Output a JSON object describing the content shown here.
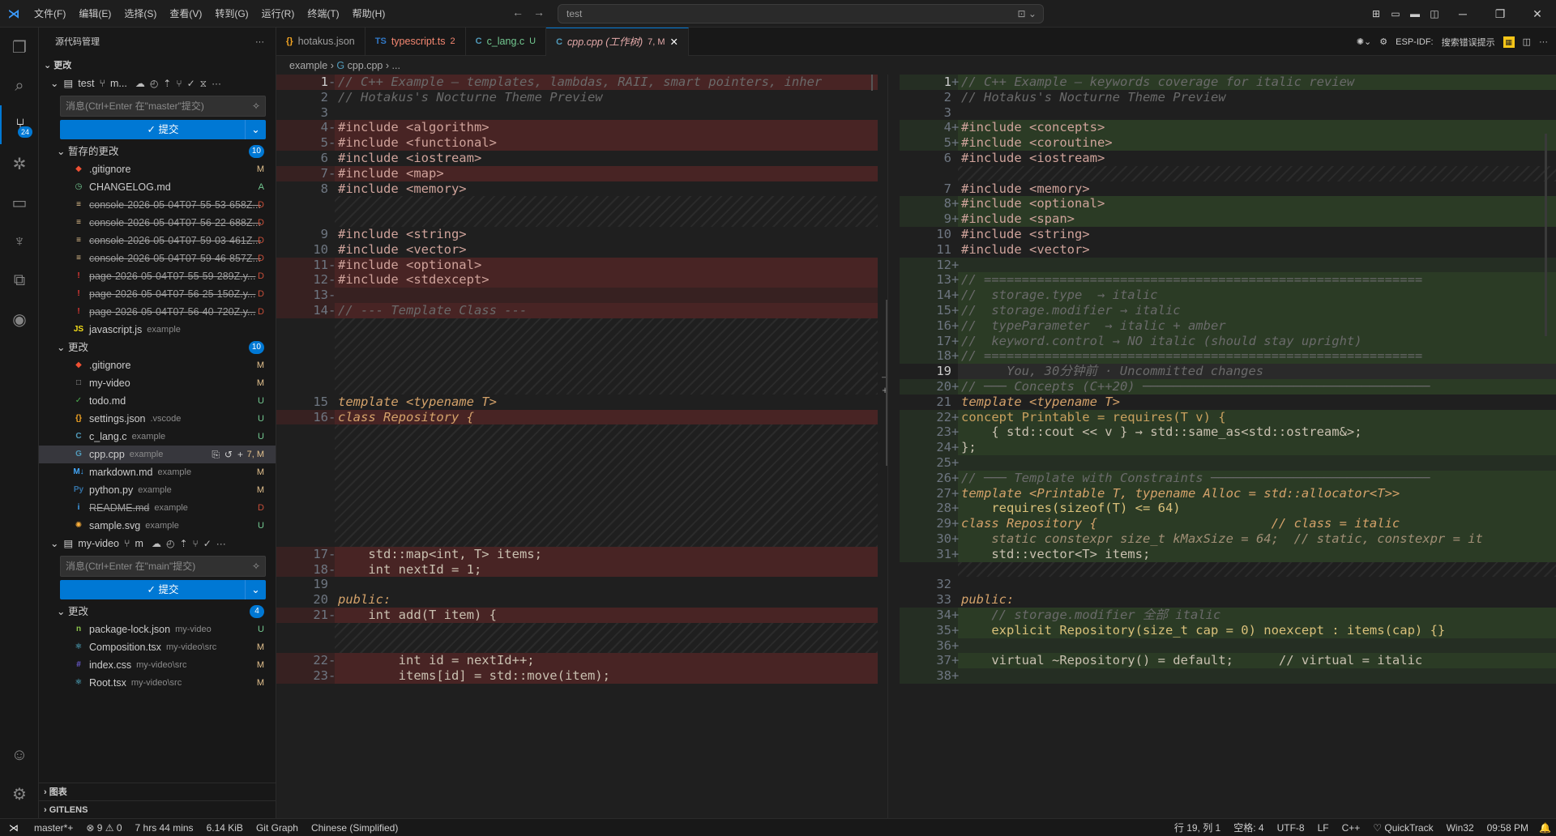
{
  "titlebar": {
    "menu": [
      "文件(F)",
      "编辑(E)",
      "选择(S)",
      "查看(V)",
      "转到(G)",
      "运行(R)",
      "终端(T)",
      "帮助(H)"
    ],
    "search": "test"
  },
  "activity_badge": "24",
  "sidebar": {
    "header": "源代码管理",
    "section": "更改",
    "repo1": {
      "name": "test",
      "branch_abbrev": "m...",
      "message_placeholder": "消息(Ctrl+Enter 在\"master\"提交)",
      "commit_label": "✓ 提交",
      "staged_label": "暂存的更改",
      "staged_count": "10",
      "staged": [
        {
          "name": ".gitignore",
          "dir": "",
          "status": "M",
          "deleted": false,
          "icon": "git"
        },
        {
          "name": "CHANGELOG.md",
          "dir": "",
          "status": "A",
          "deleted": false,
          "icon": "history"
        },
        {
          "name": "console-2026-05-04T07-55-53-658Z...",
          "dir": "",
          "status": "D",
          "deleted": true,
          "icon": "log"
        },
        {
          "name": "console-2026-05-04T07-56-22-688Z...",
          "dir": "",
          "status": "D",
          "deleted": true,
          "icon": "log"
        },
        {
          "name": "console-2026-05-04T07-59-03-461Z...",
          "dir": "",
          "status": "D",
          "deleted": true,
          "icon": "log"
        },
        {
          "name": "console-2026-05-04T07-59-46-857Z...",
          "dir": "",
          "status": "D",
          "deleted": true,
          "icon": "log"
        },
        {
          "name": "page-2026-05-04T07-55-59-289Z.y...",
          "dir": "",
          "status": "D",
          "deleted": true,
          "icon": "yaml"
        },
        {
          "name": "page-2026-05-04T07-56-25-150Z.y...",
          "dir": "",
          "status": "D",
          "deleted": true,
          "icon": "yaml"
        },
        {
          "name": "page-2026-05-04T07-56-40-720Z.y...",
          "dir": "",
          "status": "D",
          "deleted": true,
          "icon": "yaml"
        },
        {
          "name": "javascript.js",
          "dir": "example",
          "status": "",
          "deleted": false,
          "icon": "js"
        }
      ],
      "changes_label": "更改",
      "changes_count": "10",
      "changes": [
        {
          "name": ".gitignore",
          "dir": "",
          "status": "M",
          "deleted": false,
          "icon": "git"
        },
        {
          "name": "my-video",
          "dir": "",
          "status": "M",
          "deleted": false,
          "icon": "file"
        },
        {
          "name": "todo.md",
          "dir": "",
          "status": "U",
          "deleted": false,
          "icon": "check"
        },
        {
          "name": "settings.json",
          "dir": ".vscode",
          "status": "U",
          "deleted": false,
          "icon": "json"
        },
        {
          "name": "c_lang.c",
          "dir": "example",
          "status": "U",
          "deleted": false,
          "icon": "c"
        },
        {
          "name": "cpp.cpp",
          "dir": "example",
          "status": "7, M",
          "deleted": false,
          "icon": "cpp",
          "selected": true
        },
        {
          "name": "markdown.md",
          "dir": "example",
          "status": "M",
          "deleted": false,
          "icon": "md"
        },
        {
          "name": "python.py",
          "dir": "example",
          "status": "M",
          "deleted": false,
          "icon": "py"
        },
        {
          "name": "README.md",
          "dir": "example",
          "status": "D",
          "deleted": true,
          "icon": "info"
        },
        {
          "name": "sample.svg",
          "dir": "example",
          "status": "U",
          "deleted": false,
          "icon": "svg"
        }
      ]
    },
    "repo2": {
      "name": "my-video",
      "branch_abbrev": "m",
      "message_placeholder": "消息(Ctrl+Enter 在\"main\"提交)",
      "commit_label": "✓ 提交",
      "changes_label": "更改",
      "changes_count": "4",
      "changes": [
        {
          "name": "package-lock.json",
          "dir": "my-video",
          "status": "U",
          "deleted": false,
          "icon": "npm"
        },
        {
          "name": "Composition.tsx",
          "dir": "my-video\\src",
          "status": "M",
          "deleted": false,
          "icon": "react"
        },
        {
          "name": "index.css",
          "dir": "my-video\\src",
          "status": "M",
          "deleted": false,
          "icon": "css"
        },
        {
          "name": "Root.tsx",
          "dir": "my-video\\src",
          "status": "M",
          "deleted": false,
          "icon": "react"
        }
      ]
    },
    "bottom": [
      "图表",
      "GITLENS"
    ]
  },
  "tabs": [
    {
      "icon": "{}",
      "label": "hotakus.json",
      "mod": "",
      "active": false
    },
    {
      "icon": "TS",
      "label": "typescript.ts",
      "mod": "2",
      "active": false
    },
    {
      "icon": "C",
      "label": "c_lang.c",
      "mod": "U",
      "active": false
    },
    {
      "icon": "C",
      "label": "cpp.cpp (工作树)",
      "mod": "7, M",
      "active": true
    }
  ],
  "tab_right": {
    "esp": "ESP-IDF:",
    "search_hint": "搜索错误提示"
  },
  "breadcrumb": [
    "example",
    "cpp.cpp",
    "..."
  ],
  "left_editor": [
    {
      "n": "1",
      "m": "-",
      "t": "del",
      "code": "// C++ Example — templates, lambdas, RAII, smart pointers, inher",
      "cls": "c-com"
    },
    {
      "n": "2",
      "m": " ",
      "t": "",
      "code": "// Hotakus's Nocturne Theme Preview",
      "cls": "c-com"
    },
    {
      "n": "3",
      "m": " ",
      "t": "",
      "code": "",
      "cls": ""
    },
    {
      "n": "4",
      "m": "-",
      "t": "del",
      "code": "#include <algorithm>",
      "cls": "c-inc"
    },
    {
      "n": "5",
      "m": "-",
      "t": "del",
      "code": "#include <functional>",
      "cls": "c-inc"
    },
    {
      "n": "6",
      "m": " ",
      "t": "",
      "code": "#include <iostream>",
      "cls": "c-inc"
    },
    {
      "n": "7",
      "m": "-",
      "t": "del",
      "code": "#include <map>",
      "cls": "c-inc"
    },
    {
      "n": "8",
      "m": " ",
      "t": "",
      "code": "#include <memory>",
      "cls": "c-inc"
    },
    {
      "filler": 2
    },
    {
      "n": "9",
      "m": " ",
      "t": "",
      "code": "#include <string>",
      "cls": "c-inc"
    },
    {
      "n": "10",
      "m": " ",
      "t": "",
      "code": "#include <vector>",
      "cls": "c-inc"
    },
    {
      "n": "11",
      "m": "-",
      "t": "del",
      "code": "#include <optional>",
      "cls": "c-inc"
    },
    {
      "n": "12",
      "m": "-",
      "t": "del",
      "code": "#include <stdexcept>",
      "cls": "c-inc"
    },
    {
      "n": "13",
      "m": "-",
      "t": "del",
      "code": "",
      "cls": ""
    },
    {
      "n": "14",
      "m": "-",
      "t": "del",
      "code": "// --- Template Class ---",
      "cls": "c-com"
    },
    {
      "filler": 5
    },
    {
      "n": "15",
      "m": " ",
      "t": "",
      "code": "template <typename T>",
      "cls": "c-kw"
    },
    {
      "n": "16",
      "m": "-",
      "t": "del",
      "code": "class Repository {",
      "cls": "c-kw"
    },
    {
      "filler": 8
    },
    {
      "n": "17",
      "m": "-",
      "t": "del",
      "code": "    std::map<int, T> items;",
      "cls": "c-pl"
    },
    {
      "n": "18",
      "m": "-",
      "t": "del",
      "code": "    int nextId = 1;",
      "cls": "c-pl"
    },
    {
      "n": "19",
      "m": " ",
      "t": "",
      "code": "",
      "cls": ""
    },
    {
      "n": "20",
      "m": " ",
      "t": "",
      "code": "public:",
      "cls": "c-kw"
    },
    {
      "n": "21",
      "m": "-",
      "t": "del",
      "code": "    int add(T item) {",
      "cls": "c-pl"
    },
    {
      "filler": 2
    },
    {
      "n": "22",
      "m": "-",
      "t": "del",
      "code": "        int id = nextId++;",
      "cls": "c-pl"
    },
    {
      "n": "23",
      "m": "-",
      "t": "del",
      "code": "        items[id] = std::move(item);",
      "cls": "c-pl"
    }
  ],
  "right_editor": [
    {
      "n": "1",
      "m": "+",
      "t": "add",
      "code": "// C++ Example — keywords coverage for italic review",
      "cls": "c-com"
    },
    {
      "n": "2",
      "m": " ",
      "t": "",
      "code": "// Hotakus's Nocturne Theme Preview",
      "cls": "c-com"
    },
    {
      "n": "3",
      "m": " ",
      "t": "",
      "code": "",
      "cls": ""
    },
    {
      "n": "4",
      "m": "+",
      "t": "add",
      "code": "#include <concepts>",
      "cls": "c-inc"
    },
    {
      "n": "5",
      "m": "+",
      "t": "add",
      "code": "#include <coroutine>",
      "cls": "c-inc"
    },
    {
      "n": "6",
      "m": " ",
      "t": "",
      "code": "#include <iostream>",
      "cls": "c-inc"
    },
    {
      "filler": 1
    },
    {
      "n": "7",
      "m": " ",
      "t": "",
      "code": "#include <memory>",
      "cls": "c-inc"
    },
    {
      "n": "8",
      "m": "+",
      "t": "add",
      "code": "#include <optional>",
      "cls": "c-inc"
    },
    {
      "n": "9",
      "m": "+",
      "t": "add",
      "code": "#include <span>",
      "cls": "c-inc"
    },
    {
      "n": "10",
      "m": " ",
      "t": "",
      "code": "#include <string>",
      "cls": "c-inc"
    },
    {
      "n": "11",
      "m": " ",
      "t": "",
      "code": "#include <vector>",
      "cls": "c-inc"
    },
    {
      "n": "12",
      "m": "+",
      "t": "add",
      "code": "",
      "cls": ""
    },
    {
      "n": "13",
      "m": "+",
      "t": "add",
      "code": "// ==========================================================",
      "cls": "c-com"
    },
    {
      "n": "14",
      "m": "+",
      "t": "add",
      "code": "//  storage.type  → italic",
      "cls": "c-com"
    },
    {
      "n": "15",
      "m": "+",
      "t": "add",
      "code": "//  storage.modifier → italic",
      "cls": "c-com"
    },
    {
      "n": "16",
      "m": "+",
      "t": "add",
      "code": "//  typeParameter  → italic + amber",
      "cls": "c-com"
    },
    {
      "n": "17",
      "m": "+",
      "t": "add",
      "code": "//  keyword.control → NO italic (should stay upright)",
      "cls": "c-com"
    },
    {
      "n": "18",
      "m": "+",
      "t": "add",
      "code": "// ==========================================================",
      "cls": "c-com"
    },
    {
      "n": "19",
      "m": " ",
      "t": "cur",
      "code": "      You, 30分钟前 · Uncommitted changes",
      "cls": "blame"
    },
    {
      "n": "20",
      "m": "+",
      "t": "add",
      "code": "// ─── Concepts (C++20) ──────────────────────────────────────",
      "cls": "c-com"
    },
    {
      "n": "21",
      "m": " ",
      "t": "",
      "code": "template <typename T>",
      "cls": "c-kw"
    },
    {
      "n": "22",
      "m": "+",
      "t": "add",
      "code": "concept Printable = requires(T v) {",
      "cls": "c-ty"
    },
    {
      "n": "23",
      "m": "+",
      "t": "add",
      "code": "    { std::cout << v } → std::same_as<std::ostream&>;",
      "cls": "c-pl"
    },
    {
      "n": "24",
      "m": "+",
      "t": "add",
      "code": "};",
      "cls": "c-pl"
    },
    {
      "n": "25",
      "m": "+",
      "t": "add",
      "code": "",
      "cls": ""
    },
    {
      "n": "26",
      "m": "+",
      "t": "add",
      "code": "// ─── Template with Constraints ─────────────────────────────",
      "cls": "c-com"
    },
    {
      "n": "27",
      "m": "+",
      "t": "add",
      "code": "template <Printable T, typename Alloc = std::allocator<T>>",
      "cls": "c-kw"
    },
    {
      "n": "28",
      "m": "+",
      "t": "add",
      "code": "    requires(sizeof(T) <= 64)",
      "cls": "c-fn"
    },
    {
      "n": "29",
      "m": "+",
      "t": "add",
      "code": "class Repository {                       // class = italic",
      "cls": "c-kw"
    },
    {
      "n": "30",
      "m": "+",
      "t": "add",
      "code": "    static constexpr size_t kMaxSize = 64;  // static, constexpr = it",
      "cls": "c-ital"
    },
    {
      "n": "31",
      "m": "+",
      "t": "add",
      "code": "    std::vector<T> items;",
      "cls": "c-pl"
    },
    {
      "filler": 1
    },
    {
      "n": "32",
      "m": " ",
      "t": "",
      "code": "",
      "cls": ""
    },
    {
      "n": "33",
      "m": " ",
      "t": "",
      "code": "public:",
      "cls": "c-kw"
    },
    {
      "n": "34",
      "m": "+",
      "t": "add",
      "code": "    // storage.modifier 全部 italic",
      "cls": "c-com"
    },
    {
      "n": "35",
      "m": "+",
      "t": "add",
      "code": "    explicit Repository(size_t cap = 0) noexcept : items(cap) {}",
      "cls": "c-fn"
    },
    {
      "n": "36",
      "m": "+",
      "t": "add",
      "code": "",
      "cls": ""
    },
    {
      "n": "37",
      "m": "+",
      "t": "add",
      "code": "    virtual ~Repository() = default;      // virtual = italic",
      "cls": "c-pl"
    },
    {
      "n": "38",
      "m": "+",
      "t": "add",
      "code": "",
      "cls": ""
    }
  ],
  "statusbar": {
    "left": [
      "master*+",
      "⊗ 9 ⚠ 0",
      "7 hrs 44 mins",
      "6.14 KiB",
      "Git Graph",
      "Chinese (Simplified)"
    ],
    "right": [
      "行 19, 列 1",
      "空格: 4",
      "UTF-8",
      "LF",
      "C++",
      "♡ QuickTrack",
      "Win32",
      "09:58 PM"
    ]
  },
  "colors": {
    "accent": "#0078d4",
    "deleted": "#c74e39",
    "modified": "#e2c08d",
    "added": "#73c991"
  }
}
